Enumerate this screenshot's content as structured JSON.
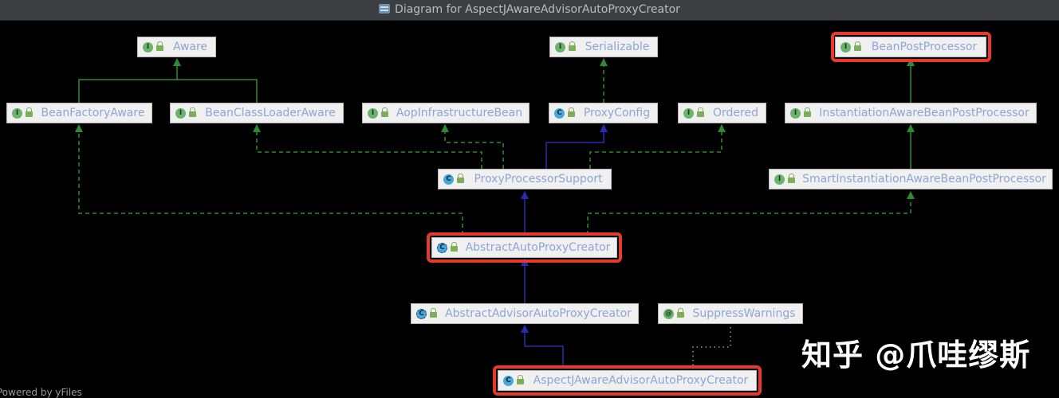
{
  "window": {
    "title": "Diagram for AspectJAwareAdvisorAutoProxyCreator"
  },
  "colors": {
    "realization": "#2f8a2f",
    "generalization": "#2a2ab0",
    "highlight": "#e8392b",
    "node_label": "#8ea5d6"
  },
  "nodes": {
    "aware": {
      "label": "Aware",
      "kind": "I"
    },
    "serializable": {
      "label": "Serializable",
      "kind": "I"
    },
    "bean_post_processor": {
      "label": "BeanPostProcessor",
      "kind": "I"
    },
    "bean_factory_aware": {
      "label": "BeanFactoryAware",
      "kind": "I"
    },
    "bean_class_loader_aware": {
      "label": "BeanClassLoaderAware",
      "kind": "I"
    },
    "aop_infrastructure_bean": {
      "label": "AopInfrastructureBean",
      "kind": "I"
    },
    "proxy_config": {
      "label": "ProxyConfig",
      "kind": "C"
    },
    "ordered": {
      "label": "Ordered",
      "kind": "I"
    },
    "instantiation_aware_bpp": {
      "label": "InstantiationAwareBeanPostProcessor",
      "kind": "I"
    },
    "proxy_processor_support": {
      "label": "ProxyProcessorSupport",
      "kind": "C"
    },
    "smart_instantiation_aware_bpp": {
      "label": "SmartInstantiationAwareBeanPostProcessor",
      "kind": "I"
    },
    "abstract_auto_proxy_creator": {
      "label": "AbstractAutoProxyCreator",
      "kind": "C"
    },
    "abstract_advisor_auto_proxy_creator": {
      "label": "AbstractAdvisorAutoProxyCreator",
      "kind": "C"
    },
    "suppress_warnings": {
      "label": "SuppressWarnings",
      "kind": "@"
    },
    "aspectj_aware_advisor_auto_proxy_creator": {
      "label": "AspectJAwareAdvisorAutoProxyCreator",
      "kind": "C"
    }
  },
  "footer": "Powered by yFiles",
  "watermark": "知乎 @爪哇缪斯"
}
